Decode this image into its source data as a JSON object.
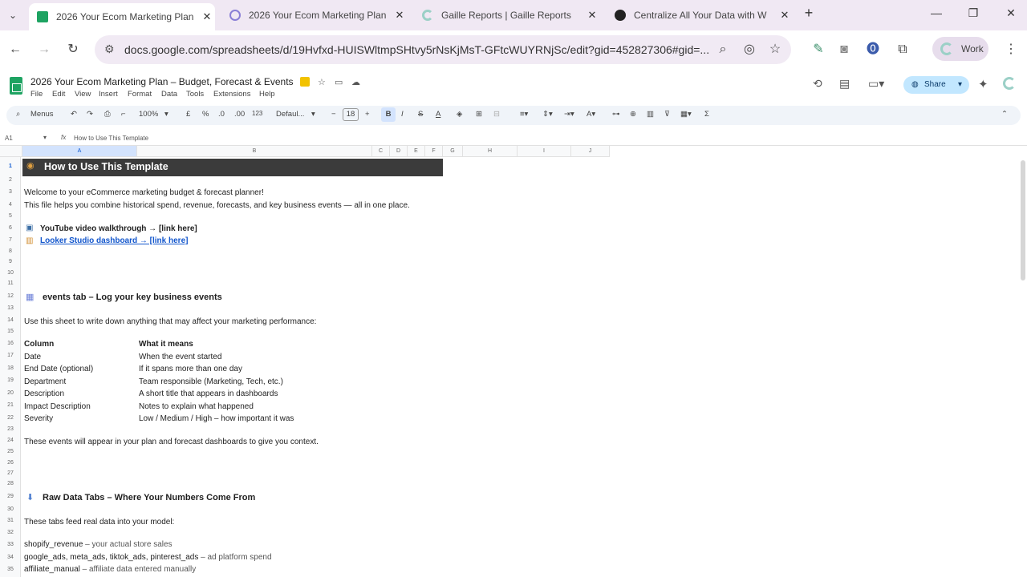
{
  "browser": {
    "tabs": [
      {
        "title": "2026 Your Ecom Marketing Plan",
        "active": true
      },
      {
        "title": "2026 Your Ecom Marketing Plan",
        "active": false
      },
      {
        "title": "Gaille Reports | Gaille Reports",
        "active": false
      },
      {
        "title": "Centralize All Your Data with W",
        "active": false
      }
    ],
    "url": "docs.google.com/spreadsheets/d/19Hvfxd-HUISWltmpSHtvy5rNsKjMsT-GFtcWUYRNjSc/edit?gid=452827306#gid=...",
    "profile_label": "Work"
  },
  "doc": {
    "title": "2026 Your Ecom Marketing Plan – Budget, Forecast & Events",
    "menus": [
      "File",
      "Edit",
      "View",
      "Insert",
      "Format",
      "Data",
      "Tools",
      "Extensions",
      "Help"
    ],
    "share_label": "Share"
  },
  "toolbar": {
    "menus_label": "Menus",
    "zoom": "100%",
    "currency": "£",
    "percent": "%",
    "dec_less": ".0",
    "dec_more": ".00",
    "num_format": "123",
    "font": "Defaul...",
    "font_size": "18"
  },
  "formula_bar": {
    "cell_ref": "A1",
    "content": "How to Use This Template"
  },
  "columns": [
    "A",
    "B",
    "C",
    "D",
    "E",
    "F",
    "G",
    "H",
    "I",
    "J"
  ],
  "sheet": {
    "title": "How to Use This Template",
    "welcome": "Welcome to your eCommerce marketing budget & forecast planner!",
    "intro": "This file helps you combine historical spend, revenue, forecasts, and key business events — all in one place.",
    "youtube": "YouTube video walkthrough → [link here]",
    "looker": "Looker Studio dashboard → [link here]",
    "events_heading": "events tab – Log your key business events",
    "events_intro": "Use this sheet to write down anything that may affect your marketing performance:",
    "events_table": {
      "headers": [
        "Column",
        "What it means"
      ],
      "rows": [
        [
          "Date",
          "When the event started"
        ],
        [
          "End Date (optional)",
          "If it spans more than one day"
        ],
        [
          "Department",
          "Team responsible (Marketing, Tech, etc.)"
        ],
        [
          "Description",
          "A short title that appears in dashboards"
        ],
        [
          "Impact Description",
          "Notes to explain what happened"
        ],
        [
          "Severity",
          "Low / Medium / High – how important it was"
        ]
      ]
    },
    "events_outro": "These events will appear in your plan and forecast dashboards to give you context.",
    "raw_heading": "Raw Data Tabs – Where Your Numbers Come From",
    "raw_intro": "These tabs feed real data into your model:",
    "raw_items": [
      {
        "name": "shopify_revenue",
        "desc": "– your actual store sales"
      },
      {
        "name": "google_ads, meta_ads, tiktok_ads, pinterest_ads",
        "desc": "– ad platform spend"
      },
      {
        "name": "affiliate_manual",
        "desc": "– affiliate data entered manually"
      }
    ]
  }
}
